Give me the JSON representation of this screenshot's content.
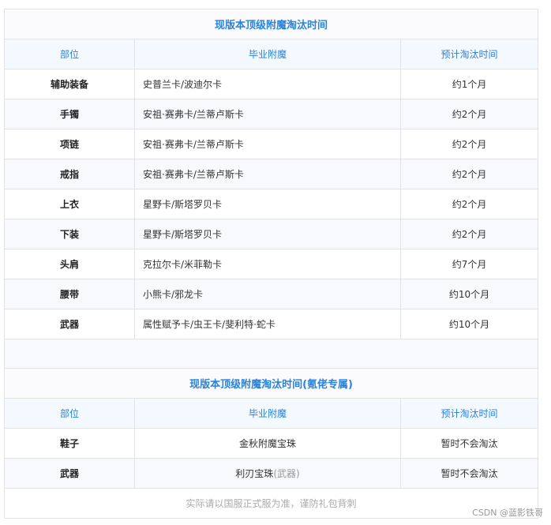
{
  "table1": {
    "title": "现版本顶级附魔淘汰时间",
    "headers": [
      "部位",
      "毕业附魔",
      "预计淘汰时间"
    ],
    "rows": [
      {
        "part": "辅助装备",
        "enchant": "史普兰卡/波迪尔卡",
        "time": "约1个月"
      },
      {
        "part": "手镯",
        "enchant": "安祖·赛弗卡/兰蒂卢斯卡",
        "time": "约2个月"
      },
      {
        "part": "项链",
        "enchant": "安祖·赛弗卡/兰蒂卢斯卡",
        "time": "约2个月"
      },
      {
        "part": "戒指",
        "enchant": "安祖·赛弗卡/兰蒂卢斯卡",
        "time": "约2个月"
      },
      {
        "part": "上衣",
        "enchant": "星野卡/斯塔罗贝卡",
        "time": "约2个月"
      },
      {
        "part": "下装",
        "enchant": "星野卡/斯塔罗贝卡",
        "time": "约2个月"
      },
      {
        "part": "头肩",
        "enchant": "克拉尔卡/米菲勒卡",
        "time": "约7个月"
      },
      {
        "part": "腰带",
        "enchant": "小熊卡/邪龙卡",
        "time": "约10个月"
      },
      {
        "part": "武器",
        "enchant": "属性赋予卡/虫王卡/斐利特·蛇卡",
        "time": "约10个月"
      }
    ]
  },
  "table2": {
    "title": "现版本顶级附魔淘汰时间(氪佬专属)",
    "headers": [
      "部位",
      "毕业附魔",
      "预计淘汰时间"
    ],
    "rows": [
      {
        "part": "鞋子",
        "enchant": "金秋附魔宝珠",
        "enchant_sub": "",
        "time": "暂时不会淘汰"
      },
      {
        "part": "武器",
        "enchant": "利刃宝珠",
        "enchant_sub": "(武器)",
        "time": "暂时不会淘汰"
      }
    ],
    "note": "实际请以国服正式服为准，谨防礼包背刺"
  },
  "watermark": "CSDN @蓝影铁哥"
}
